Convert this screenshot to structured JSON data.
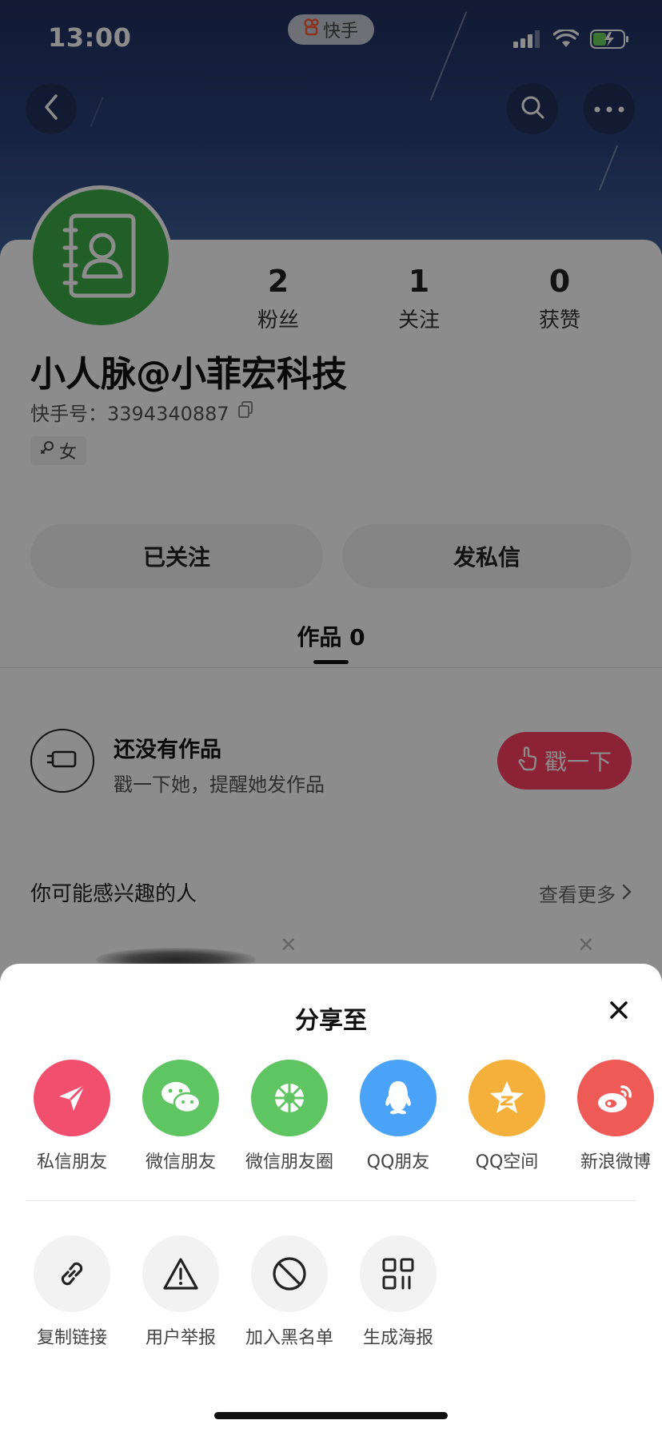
{
  "status_bar": {
    "time": "13:00",
    "app_pill_label": "快手"
  },
  "profile": {
    "name": "小人脉@小菲宏科技",
    "uid_label": "快手号：3394340887",
    "gender": "女",
    "stats": [
      {
        "value": "2",
        "label": "粉丝"
      },
      {
        "value": "1",
        "label": "关注"
      },
      {
        "value": "0",
        "label": "获赞"
      }
    ],
    "followed_button": "已关注",
    "message_button": "发私信",
    "works_tab": "作品 0"
  },
  "empty_state": {
    "title": "还没有作品",
    "subtitle": "戳一下她，提醒她发作品",
    "poke_button": "戳一下"
  },
  "suggestions": {
    "title": "你可能感兴趣的人",
    "see_more": "查看更多"
  },
  "share_sheet": {
    "title": "分享至",
    "primary": [
      {
        "label": "私信朋友",
        "color": "#f0506e",
        "icon": "paper-plane-icon"
      },
      {
        "label": "微信朋友",
        "color": "#5fc462",
        "icon": "wechat-icon"
      },
      {
        "label": "微信朋友圈",
        "color": "#5fc462",
        "icon": "moments-icon"
      },
      {
        "label": "QQ朋友",
        "color": "#4aa3f7",
        "icon": "qq-icon"
      },
      {
        "label": "QQ空间",
        "color": "#f4b03a",
        "icon": "qzone-icon"
      },
      {
        "label": "新浪微博",
        "color": "#ee5a55",
        "icon": "weibo-icon"
      }
    ],
    "secondary": [
      {
        "label": "复制链接",
        "icon": "link-icon"
      },
      {
        "label": "用户举报",
        "icon": "warning-icon"
      },
      {
        "label": "加入黑名单",
        "icon": "block-icon"
      },
      {
        "label": "生成海报",
        "icon": "poster-grid-icon"
      }
    ]
  }
}
